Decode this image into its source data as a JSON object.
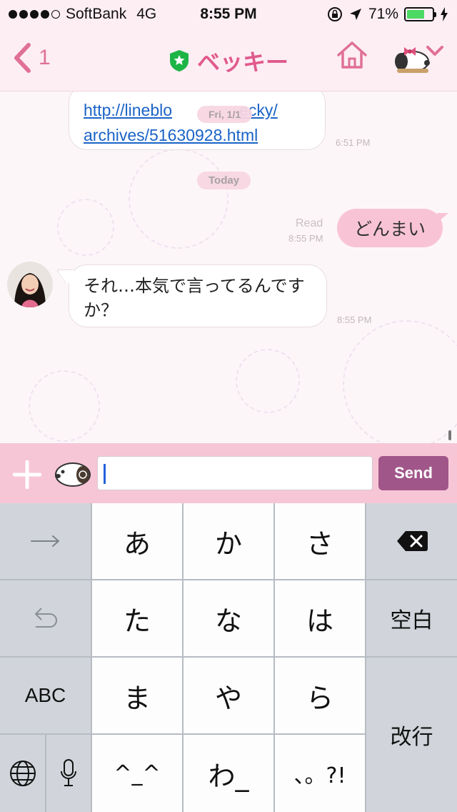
{
  "status_bar": {
    "carrier": "SoftBank",
    "network": "4G",
    "time": "8:55 PM",
    "battery_percent": "71%",
    "battery_level": 0.71,
    "signal_bars_filled": 4,
    "signal_bars_total": 5
  },
  "nav": {
    "back_count": "1",
    "title": "ベッキー",
    "icons": [
      "back-chevron",
      "verified-star",
      "home",
      "snoopy-avatar",
      "dropdown-chevron"
    ]
  },
  "chat": {
    "link_line1": "http://lineblo",
    "link_line1_end": "ecky/",
    "link_line2": "archives/51630928.html",
    "friday_pill": "Fri, 1/1",
    "link_time": "6:51 PM",
    "today_pill": "Today",
    "sent_read": "Read",
    "sent_time": "8:55 PM",
    "sent_text": "どんまい",
    "reply_text": "それ…本気で言ってるんですか？",
    "reply_time": "8:55 PM"
  },
  "input": {
    "value": "",
    "send_label": "Send"
  },
  "keyboard": {
    "row1": [
      "あ",
      "か",
      "さ"
    ],
    "row2": [
      "た",
      "な",
      "は"
    ],
    "row3": [
      "ま",
      "や",
      "ら"
    ],
    "row4": [
      "^_^",
      "わ_",
      "、。?!"
    ],
    "space_label": "空白",
    "abc_label": "ABC",
    "return_label": "改行"
  },
  "colors": {
    "accent_pink": "#e05a8c",
    "send_purple": "#a1568a",
    "link_blue": "#1a63c7"
  }
}
